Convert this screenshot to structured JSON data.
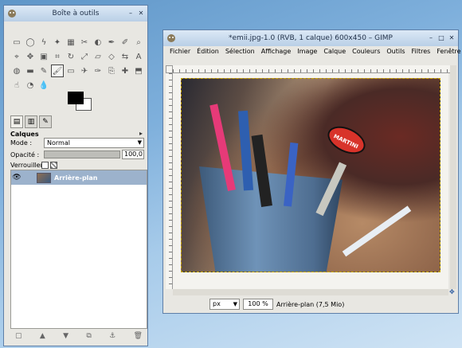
{
  "toolbox": {
    "title": "Boîte à outils",
    "tools": [
      "rect-select",
      "ellipse-select",
      "free-select",
      "fuzzy-select",
      "select-by-color",
      "scissors",
      "foreground-select",
      "paths",
      "color-picker",
      "zoom",
      "measure",
      "move",
      "align",
      "crop",
      "rotate",
      "scale",
      "shear",
      "perspective",
      "flip",
      "text",
      "bucket-fill",
      "blend",
      "pencil",
      "paintbrush",
      "eraser",
      "airbrush",
      "ink",
      "clone",
      "heal",
      "perspective-clone",
      "smudge",
      "dodge-burn",
      "convolve"
    ],
    "active_tool_index": 23,
    "colors": {
      "foreground": "#000000",
      "background": "#ffffff"
    }
  },
  "layers": {
    "title": "Calques",
    "mode_label": "Mode :",
    "mode_value": "Normal",
    "opacity_label": "Opacité :",
    "opacity_value": "100,0",
    "lock_label": "Verrouiller :",
    "items": [
      {
        "name": "Arrière-plan",
        "visible": true,
        "selected": true
      }
    ],
    "buttons": [
      "new-layer",
      "raise-layer",
      "lower-layer",
      "duplicate-layer",
      "anchor-layer",
      "delete-layer"
    ]
  },
  "image_window": {
    "title": "*emii.jpg-1.0 (RVB, 1 calque) 600x450 – GIMP",
    "menu": [
      "Fichier",
      "Édition",
      "Sélection",
      "Affichage",
      "Image",
      "Calque",
      "Couleurs",
      "Outils",
      "Filtres",
      "Fenêtre"
    ],
    "unit": "px",
    "zoom": "100 %",
    "status": "Arrière-plan (7,5 Mio)",
    "photo_label": "MARTINI",
    "ruler_h_labels": [
      "0",
      "100",
      "200",
      "300"
    ],
    "ruler_v_labels": [
      "0",
      "100",
      "200",
      "300",
      "400"
    ]
  }
}
